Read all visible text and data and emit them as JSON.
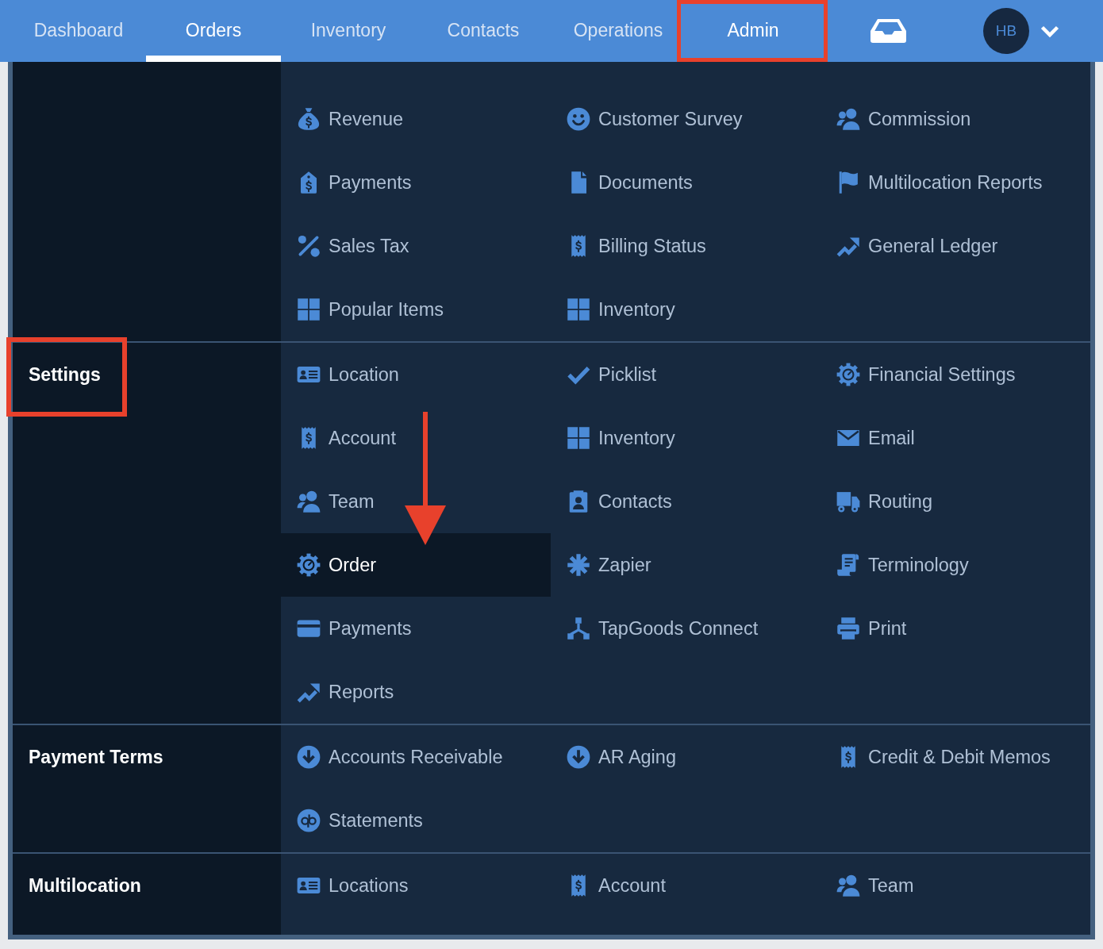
{
  "nav": {
    "tabs": [
      {
        "label": "Dashboard",
        "selected": false,
        "expanded": false,
        "annotated": false
      },
      {
        "label": "Orders",
        "selected": true,
        "expanded": false,
        "annotated": false
      },
      {
        "label": "Inventory",
        "selected": false,
        "expanded": false,
        "annotated": false
      },
      {
        "label": "Contacts",
        "selected": false,
        "expanded": false,
        "annotated": false
      },
      {
        "label": "Operations",
        "selected": false,
        "expanded": false,
        "annotated": false
      },
      {
        "label": "Admin",
        "selected": false,
        "expanded": true,
        "annotated": true
      }
    ],
    "user": {
      "initials": "HB"
    }
  },
  "menu": {
    "sections": [
      {
        "annotated": false,
        "items": [
          {
            "label": "Revenue",
            "kind": "moneybag",
            "selected": false,
            "annotated": false
          },
          {
            "label": "Customer Survey",
            "kind": "smiley",
            "selected": false,
            "annotated": false
          },
          {
            "label": "Commission",
            "kind": "users",
            "selected": false,
            "annotated": false
          },
          {
            "label": "Payments",
            "kind": "tag",
            "selected": false,
            "annotated": false
          },
          {
            "label": "Documents",
            "kind": "file",
            "selected": false,
            "annotated": false
          },
          {
            "label": "Multilocation Reports",
            "kind": "flag",
            "selected": false,
            "annotated": false
          },
          {
            "label": "Sales Tax",
            "kind": "percent",
            "selected": false,
            "annotated": false
          },
          {
            "label": "Billing Status",
            "kind": "receipt",
            "selected": false,
            "annotated": false
          },
          {
            "label": "General Ledger",
            "kind": "trend",
            "selected": false,
            "annotated": false
          },
          {
            "label": "Popular Items",
            "kind": "grid",
            "selected": false,
            "annotated": false
          },
          {
            "label": "Inventory",
            "kind": "grid",
            "selected": false,
            "annotated": false
          }
        ]
      },
      {
        "title": "Settings",
        "annotated": true,
        "items": [
          {
            "label": "Location",
            "kind": "idcard",
            "selected": false,
            "annotated": false
          },
          {
            "label": "Picklist",
            "kind": "check",
            "selected": false,
            "annotated": false
          },
          {
            "label": "Financial Settings",
            "kind": "gear",
            "selected": false,
            "annotated": false
          },
          {
            "label": "Account",
            "kind": "receipt",
            "selected": false,
            "annotated": false
          },
          {
            "label": "Inventory",
            "kind": "grid",
            "selected": false,
            "annotated": false
          },
          {
            "label": "Email",
            "kind": "envelope",
            "selected": false,
            "annotated": false
          },
          {
            "label": "Team",
            "kind": "users",
            "selected": false,
            "annotated": false
          },
          {
            "label": "Contacts",
            "kind": "contactbook",
            "selected": false,
            "annotated": false
          },
          {
            "label": "Routing",
            "kind": "truck",
            "selected": false,
            "annotated": false
          },
          {
            "label": "Order",
            "kind": "gear",
            "selected": true,
            "annotated": true
          },
          {
            "label": "Zapier",
            "kind": "asterisk",
            "selected": false,
            "annotated": false
          },
          {
            "label": "Terminology",
            "kind": "scroll",
            "selected": false,
            "annotated": false
          },
          {
            "label": "Payments",
            "kind": "card",
            "selected": false,
            "annotated": false
          },
          {
            "label": "TapGoods Connect",
            "kind": "network",
            "selected": false,
            "annotated": false
          },
          {
            "label": "Print",
            "kind": "printer",
            "selected": false,
            "annotated": false
          },
          {
            "label": "Reports",
            "kind": "trend",
            "selected": false,
            "annotated": false
          }
        ]
      },
      {
        "title": "Payment Terms",
        "annotated": false,
        "items": [
          {
            "label": "Accounts Receivable",
            "kind": "download",
            "selected": false,
            "annotated": false
          },
          {
            "label": "AR Aging",
            "kind": "download",
            "selected": false,
            "annotated": false
          },
          {
            "label": "Credit & Debit Memos",
            "kind": "receipt",
            "selected": false,
            "annotated": false
          },
          {
            "label": "Statements",
            "kind": "logo",
            "selected": false,
            "annotated": false
          }
        ]
      },
      {
        "title": "Multilocation",
        "annotated": false,
        "items": [
          {
            "label": "Locations",
            "kind": "idcard",
            "selected": false,
            "annotated": false
          },
          {
            "label": "Account",
            "kind": "receipt",
            "selected": false,
            "annotated": false
          },
          {
            "label": "Team",
            "kind": "users",
            "selected": false,
            "annotated": false
          }
        ]
      }
    ]
  }
}
